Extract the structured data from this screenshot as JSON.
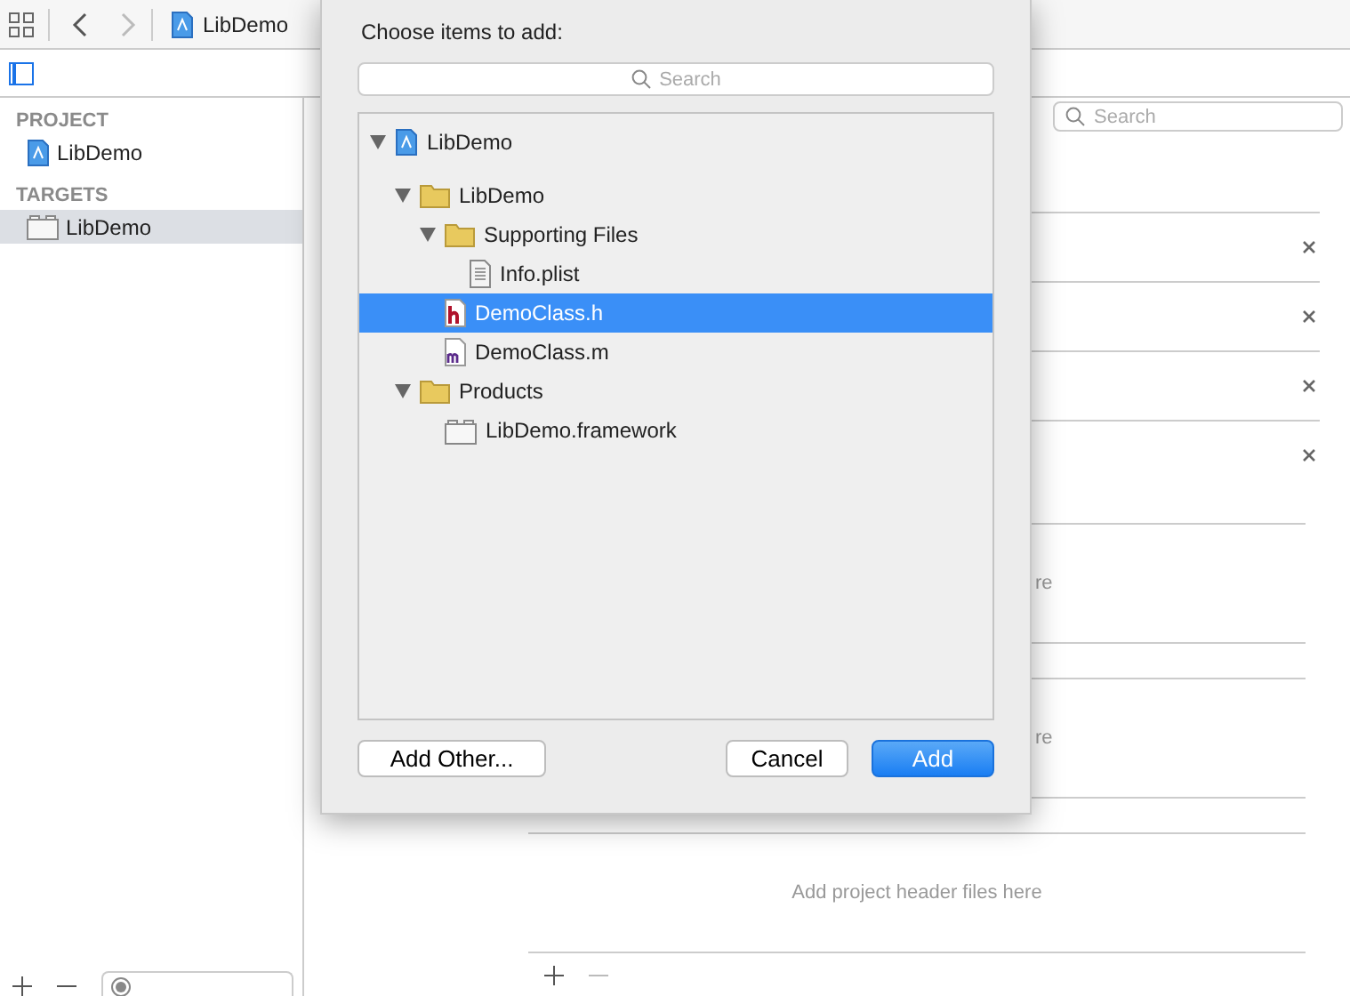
{
  "toolbar": {
    "breadcrumb": "LibDemo",
    "forward_disabled": true
  },
  "sidebar": {
    "sections": [
      {
        "header": "PROJECT",
        "items": [
          {
            "label": "LibDemo",
            "kind": "project",
            "selected": false
          }
        ]
      },
      {
        "header": "TARGETS",
        "items": [
          {
            "label": "LibDemo",
            "kind": "framework",
            "selected": true
          }
        ]
      }
    ]
  },
  "editor": {
    "search": {
      "placeholder": "Search"
    },
    "partial_texts": [
      "re",
      "re"
    ],
    "empty_hint": "Add project header files here"
  },
  "dialog": {
    "title": "Choose items to add:",
    "search": {
      "placeholder": "Search"
    },
    "tree": [
      {
        "label": "LibDemo",
        "kind": "project",
        "expanded": true,
        "selected": false,
        "children": [
          {
            "label": "LibDemo",
            "kind": "folder",
            "expanded": true,
            "selected": false,
            "children": [
              {
                "label": "Supporting Files",
                "kind": "folder",
                "expanded": true,
                "selected": false,
                "children": [
                  {
                    "label": "Info.plist",
                    "kind": "plist",
                    "selected": false
                  }
                ]
              },
              {
                "label": "DemoClass.h",
                "kind": "header",
                "selected": true
              },
              {
                "label": "DemoClass.m",
                "kind": "source",
                "selected": false
              }
            ]
          },
          {
            "label": "Products",
            "kind": "folder",
            "expanded": true,
            "selected": false,
            "children": [
              {
                "label": "LibDemo.framework",
                "kind": "framework",
                "selected": false
              }
            ]
          }
        ]
      }
    ],
    "buttons": [
      {
        "label": "Add Other...",
        "kind": "secondary"
      },
      {
        "label": "Cancel",
        "kind": "secondary"
      },
      {
        "label": "Add",
        "kind": "primary"
      }
    ]
  }
}
